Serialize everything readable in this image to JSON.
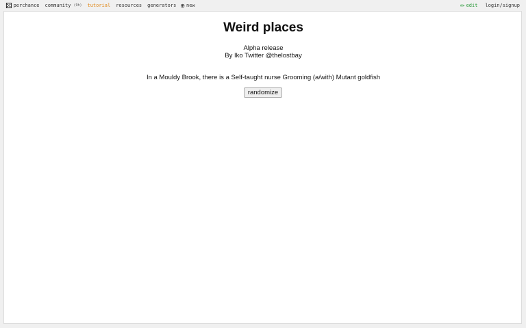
{
  "topbar": {
    "logo_icon": "⚄",
    "brand": "perchance",
    "community": {
      "icon": "",
      "label": "community",
      "badge": "(9h)"
    },
    "tutorial": {
      "icon": "",
      "label": "tutorial",
      "color": "#e0891b"
    },
    "resources": {
      "icon": "",
      "label": "resources"
    },
    "generators": {
      "icon": "",
      "label": "generators"
    },
    "new": {
      "icon": "⊕",
      "label": "new"
    },
    "edit": {
      "icon": "✏",
      "label": "edit",
      "color": "#2b9a3a"
    },
    "login": {
      "icon": "",
      "label": "login/signup"
    }
  },
  "page": {
    "title": "Weird places",
    "release": "Alpha release",
    "byline": "By Iko Twitter @thelostbay",
    "output": "In a Mouldy Brook, there is a Self-taught nurse Grooming (a/with) Mutant goldfish",
    "button_label": "randomize"
  }
}
